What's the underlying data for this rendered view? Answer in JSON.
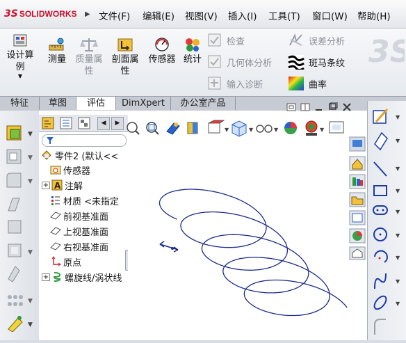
{
  "app": {
    "brand_prefix": "3S",
    "brand_name": "SOLIDWORKS",
    "brand_color": "#c8102e"
  },
  "menu": [
    "文件(F)",
    "编辑(E)",
    "视图(V)",
    "插入(I)",
    "工具(T)",
    "窗口(W)",
    "帮助(H)"
  ],
  "command_manager": {
    "buttons": [
      {
        "label1": "设计算",
        "label2": "例",
        "icon": "design-study-icon",
        "enabled": true
      },
      {
        "label1": "测量",
        "label2": "",
        "icon": "measure-icon",
        "enabled": true
      },
      {
        "label1": "质量属",
        "label2": "性",
        "icon": "mass-properties-icon",
        "enabled": false
      },
      {
        "label1": "剖面属",
        "label2": "性",
        "icon": "section-properties-icon",
        "enabled": true
      },
      {
        "label1": "传感器",
        "label2": "",
        "icon": "sensor-icon",
        "enabled": true
      },
      {
        "label1": "统计",
        "label2": "",
        "icon": "statistics-icon",
        "enabled": true
      }
    ],
    "check_items": [
      "检查",
      "几何体分析",
      "输入诊断"
    ],
    "analysis_items": [
      "误差分析",
      "斑马条纹",
      "曲率"
    ]
  },
  "tabs": [
    "特征",
    "草图",
    "评估",
    "DimXpert",
    "办公室产品"
  ],
  "active_tab": "评估",
  "tree": {
    "root": "零件2 (默认<<",
    "nodes": [
      {
        "label": "传感器",
        "icon": "sensor-folder-icon",
        "expandable": false
      },
      {
        "label": "注解",
        "icon": "annotation-icon",
        "expandable": true
      },
      {
        "label": "材质 <未指定",
        "icon": "material-icon",
        "expandable": false
      },
      {
        "label": "前视基准面",
        "icon": "plane-icon",
        "expandable": false
      },
      {
        "label": "上视基准面",
        "icon": "plane-icon",
        "expandable": false
      },
      {
        "label": "右视基准面",
        "icon": "plane-icon",
        "expandable": false
      },
      {
        "label": "原点",
        "icon": "origin-icon",
        "expandable": false
      },
      {
        "label": "螺旋线/涡状线",
        "icon": "helix-icon",
        "expandable": true
      }
    ]
  },
  "colors": {
    "helix": "#1a2a8c",
    "sketch_icons": "#1b3aa8"
  }
}
